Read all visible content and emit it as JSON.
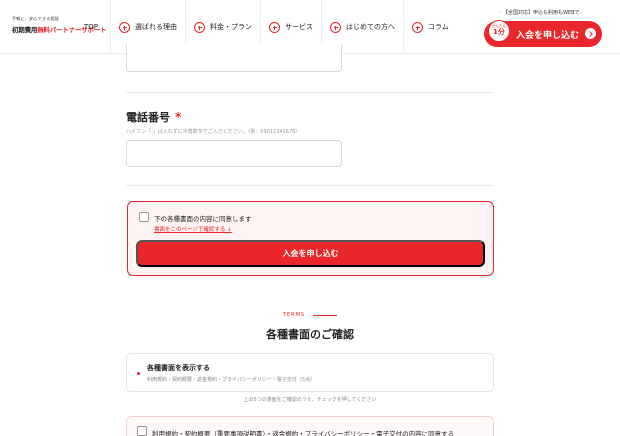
{
  "header": {
    "logo_tagline": "手軽に、安心できる相談",
    "logo_name_black": "初期費用",
    "logo_name_red": "無料パートナーサポート",
    "nav": [
      {
        "label": "TOP",
        "icon": "none"
      },
      {
        "label": "選ばれる理由",
        "icon": "plus-circle-icon"
      },
      {
        "label": "料金・プラン",
        "icon": "plus-circle-icon"
      },
      {
        "label": "サービス",
        "icon": "plus-circle-icon"
      },
      {
        "label": "はじめての方へ",
        "icon": "plus-circle-icon"
      },
      {
        "label": "コラム",
        "icon": "plus-circle-icon"
      }
    ],
    "cta_note": "【全国対応】申込も利用もWEBで",
    "cta_badge_top": "かんたん",
    "cta_badge_num": "1分",
    "cta_label": "入会を申し込む"
  },
  "form": {
    "phone_label": "電話番号",
    "required_mark": "*",
    "phone_hint": "ハイフン「-」は入れずに半角数字でご入力ください。（例：09012345678）",
    "phone_value": "",
    "agree_text": "下の各種書面の内容に同意します",
    "agree_link": "書面をこのページで確認する ↓",
    "submit_label": "入会を申し込む"
  },
  "terms": {
    "eyebrow": "TERMS",
    "title": "各種書面のご確認",
    "doc_title": "各種書面を表示する",
    "doc_sub": "利用規約・契約概要・返金規約・プライバシーポリシー・電子交付（5点）",
    "note": "上の5つの書面をご確認のうえ、チェックを押してください",
    "agree2_text": "利用規約・契約概要（重要事項説明書）・返金規約・プライバシーポリシー・電子交付の内容に同意する"
  },
  "colors": {
    "accent": "#e8262b",
    "agree_bg": "#fff4f4"
  }
}
